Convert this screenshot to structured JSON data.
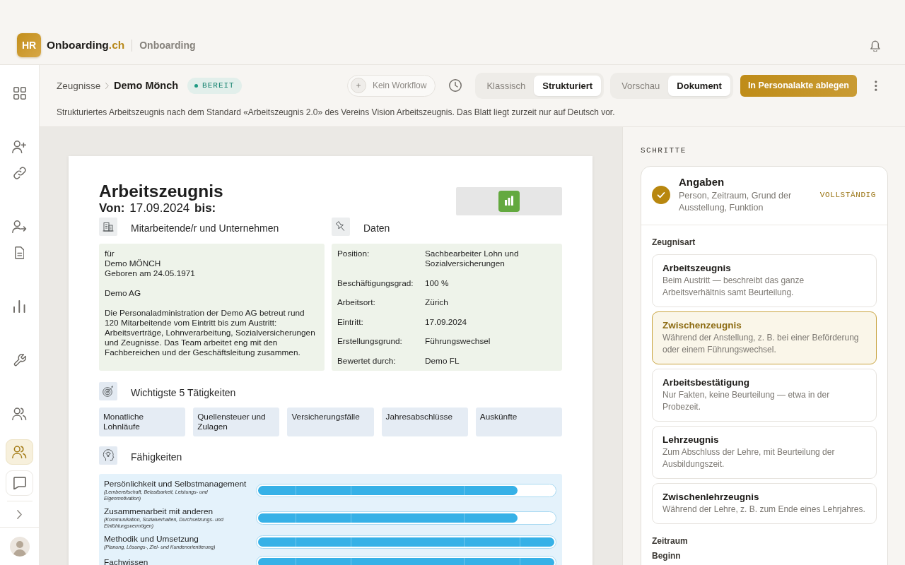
{
  "app": {
    "logo": "HR",
    "brand": "Onboarding",
    "brand_suffix": ".ch",
    "section": "Onboarding"
  },
  "sidebar": {
    "groups": [
      [
        {
          "selected": false
        }
      ],
      [
        {
          "selected": false
        },
        {
          "selected": false
        }
      ],
      [
        {
          "selected": false
        },
        {
          "selected": false
        }
      ],
      [
        {
          "selected": false
        }
      ],
      [
        {
          "selected": false
        }
      ],
      [
        {
          "selected": false
        }
      ]
    ],
    "tools": [
      {
        "selected": true
      },
      {
        "selected": false
      }
    ]
  },
  "toolbar": {
    "breadcrumb": [
      "Zeugnisse",
      "Demo Mönch"
    ],
    "status": "BEREIT",
    "workflow": "Kein Workflow",
    "view_modes": [
      {
        "label": "Klassisch",
        "selected": false
      },
      {
        "label": "Strukturiert",
        "selected": true
      }
    ],
    "display_modes": [
      {
        "label": "Vorschau",
        "selected": false
      },
      {
        "label": "Dokument",
        "selected": true
      }
    ],
    "primary_action": "In Personalakte ablegen",
    "description": "Strukturiertes Arbeitszeugnis nach dem Standard «Arbeitszeugnis 2.0» des Vereins Vision Arbeitszeugnis. Das Blatt liegt zurzeit nur auf Deutsch vor."
  },
  "document": {
    "title": "Arbeitszeugnis",
    "period": "**Von:** 17.09.2024 **bis:**",
    "employee": {
      "title": "Mitarbeitende/r und Unternehmen",
      "blocks": [
        [
          "für",
          "Demo MÖNCH",
          "Geboren am 24.05.1971"
        ],
        [
          "Demo AG"
        ],
        [
          "Die Personaladministration der Demo AG betreut rund 120 Mitarbeitende vom Eintritt bis zum Austritt: Arbeitsverträge, Lohnverarbeitung, Sozialversicherungen und Zeugnisse. Das Team arbeitet eng mit den Fachbereichen und der Geschäftsleitung zusammen."
        ]
      ]
    },
    "details": {
      "title": "Daten",
      "rows": [
        {
          "label": "Position:",
          "value": "Sachbearbeiter Lohn und Sozialversicherungen"
        },
        {
          "label": "Beschäftigungsgrad:",
          "value": "100 %"
        },
        {
          "label": "Arbeitsort:",
          "value": "Zürich"
        },
        {
          "label": "Eintritt:",
          "value": "17.09.2024"
        },
        {
          "label": "Erstellungsgrund:",
          "value": "Führungswechsel"
        },
        {
          "label": "Bewertet durch:",
          "value": "Demo FL"
        }
      ]
    },
    "activities": {
      "title": "Wichtigste 5 Tätigkeiten",
      "items": [
        "Monatliche Lohnläufe",
        "Quellensteuer und Zulagen",
        "Versicherungsfälle",
        "Jahresabschlüsse",
        "Auskünfte"
      ]
    },
    "skills": {
      "title": "Fähigkeiten",
      "items": [
        {
          "name": "Persönlichkeit und Selbstmanagement",
          "detail": "(Lernbereitschaft, Belastbarkeit, Leistungs- und Eigenmotivation)",
          "level": 0.875
        },
        {
          "name": "Zusammenarbeit mit anderen",
          "detail": "(Kommunikation, Sozialverhalten, Durchsetzungs- und Einfühlungsvermögen)",
          "level": 0.875
        },
        {
          "name": "Methodik und Umsetzung",
          "detail": "(Planung, Lösungs-, Ziel- und Kundenorientierung)",
          "level": 1
        },
        {
          "name": "Fachwissen",
          "level": 1
        }
      ]
    }
  },
  "steps": {
    "heading": "SCHRITTE",
    "current": {
      "title": "Angaben",
      "subtitle": "Person, Zeitraum, Grund der Ausstellung, Funktion",
      "status": "VOLLSTÄNDIG",
      "done": true
    },
    "certificate_type": {
      "label": "Zeugnisart",
      "options": [
        {
          "title": "Arbeitszeugnis",
          "description": "Beim Austritt — beschreibt das ganze Arbeitsverhältnis samt Beurteilung.",
          "selected": false
        },
        {
          "title": "Zwischenzeugnis",
          "description": "Während der Anstellung, z. B. bei einer Beförderung oder einem Führungswechsel.",
          "selected": true
        },
        {
          "title": "Arbeitsbestätigung",
          "description": "Nur Fakten, keine Beurteilung — etwa in der Probezeit.",
          "selected": false
        },
        {
          "title": "Lehrzeugnis",
          "description": "Zum Abschluss der Lehre, mit Beurteilung der Ausbildungszeit.",
          "selected": false
        },
        {
          "title": "Zwischenlehrzeugnis",
          "description": "Während der Lehre, z. B. zum Ende eines Lehrjahres.",
          "selected": false
        }
      ]
    },
    "period": {
      "label": "Zeitraum",
      "fields": [
        "Beginn"
      ]
    }
  }
}
